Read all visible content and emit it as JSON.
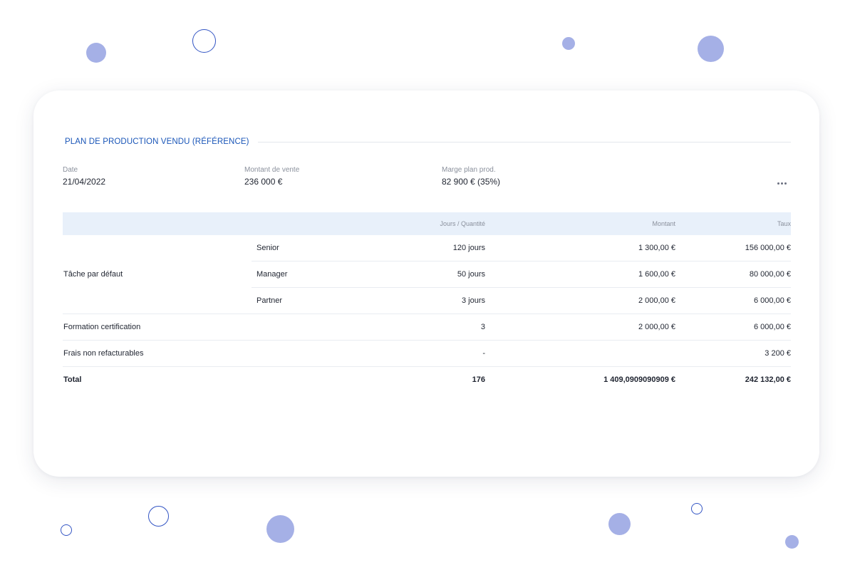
{
  "section": {
    "title": "PLAN DE PRODUCTION VENDU  (RÉFÉRENCE)"
  },
  "summary": {
    "date_label": "Date",
    "date_value": "21/04/2022",
    "amount_label": "Montant de vente",
    "amount_value": "236 000 €",
    "margin_label": "Marge plan prod.",
    "margin_value": "82 900 € (35%)",
    "more_icon": "more-horizontal-icon"
  },
  "table": {
    "headers": {
      "col1": "",
      "col2": "",
      "days_qty": "Jours / Quantité",
      "amount": "Montant",
      "rate": "Taux"
    },
    "group": {
      "label": "Tâche par défaut",
      "rows": [
        {
          "role": "Senior",
          "days": "120 jours",
          "amount": "1 300,00 €",
          "rate": "156 000,00 €"
        },
        {
          "role": "Manager",
          "days": "50 jours",
          "amount": "1 600,00 €",
          "rate": "80 000,00 €"
        },
        {
          "role": "Partner",
          "days": "3 jours",
          "amount": "2 000,00 €",
          "rate": "6 000,00 €"
        }
      ]
    },
    "rows": [
      {
        "label": "Formation certification",
        "days": "3",
        "amount": "2 000,00 €",
        "rate": "6 000,00 €"
      },
      {
        "label": "Frais non refacturables",
        "days": "-",
        "amount": "",
        "rate": "3 200 €"
      }
    ],
    "total": {
      "label": "Total",
      "days": "176",
      "amount": "1 409,0909090909 €",
      "rate": "242 132,00 €"
    }
  },
  "colors": {
    "accent": "#1a56b8",
    "header_bg": "#e8f0fa",
    "dot_fill": "#a5b0e6",
    "dot_ring": "#3355c4"
  }
}
